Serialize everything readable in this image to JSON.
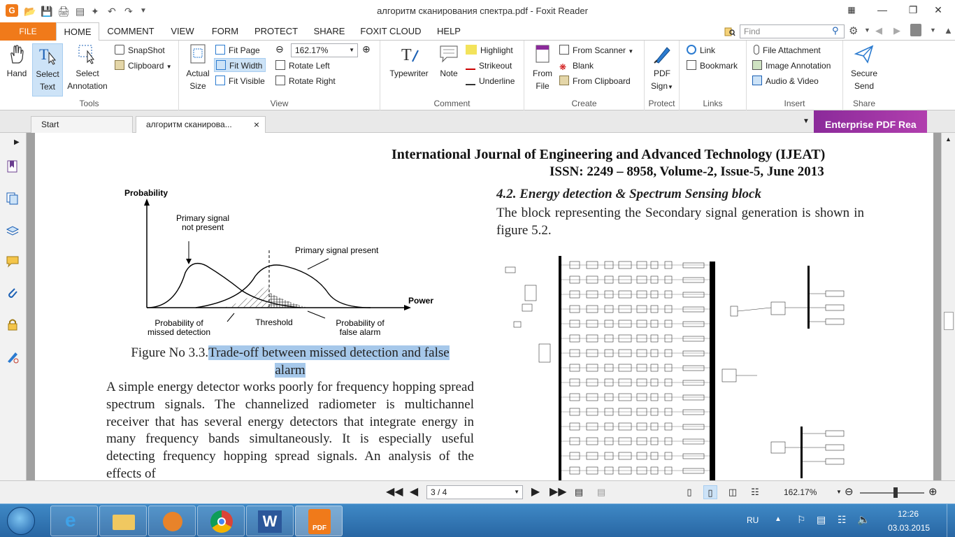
{
  "window": {
    "title": "алгоритм сканирования спектра.pdf - Foxit Reader",
    "min_label": "—",
    "max_label": "❐",
    "close_label": "✕",
    "help_label": "?"
  },
  "menu": {
    "file": "FILE",
    "tabs": [
      "HOME",
      "COMMENT",
      "VIEW",
      "FORM",
      "PROTECT",
      "SHARE",
      "FOXIT CLOUD",
      "HELP"
    ],
    "find_placeholder": "Find"
  },
  "ribbon": {
    "tools": {
      "hand": "Hand",
      "select_text_1": "Select",
      "select_text_2": "Text",
      "select_ann_1": "Select",
      "select_ann_2": "Annotation",
      "snapshot": "SnapShot",
      "clipboard": "Clipboard",
      "label": "Tools"
    },
    "view": {
      "actual_1": "Actual",
      "actual_2": "Size",
      "fit_page": "Fit Page",
      "fit_width": "Fit Width",
      "fit_visible": "Fit Visible",
      "zoom": "162.17%",
      "rotate_left": "Rotate Left",
      "rotate_right": "Rotate Right",
      "label": "View"
    },
    "comment": {
      "typewriter": "Typewriter",
      "note": "Note",
      "highlight": "Highlight",
      "strikeout": "Strikeout",
      "underline": "Underline",
      "label": "Comment"
    },
    "create": {
      "from_file_1": "From",
      "from_file_2": "File",
      "from_scanner": "From Scanner",
      "blank": "Blank",
      "from_clipboard": "From Clipboard",
      "label": "Create"
    },
    "protect": {
      "pdf_sign_1": "PDF",
      "pdf_sign_2": "Sign",
      "label": "Protect"
    },
    "links": {
      "link": "Link",
      "bookmark": "Bookmark",
      "label": "Links"
    },
    "insert": {
      "file_attachment": "File Attachment",
      "image_annotation": "Image Annotation",
      "audio_video": "Audio & Video",
      "label": "Insert"
    },
    "share": {
      "secure_1": "Secure",
      "secure_2": "Send",
      "label": "Share"
    }
  },
  "doctabs": {
    "start": "Start",
    "current": "алгоритм сканирова...",
    "close": "×",
    "enterprise": "Enterprise PDF Rea"
  },
  "document": {
    "journal_line1": "International Journal of Engineering and Advanced Technology (IJEAT)",
    "journal_line2": "ISSN: 2249 – 8958, Volume-2, Issue-5, June 2013",
    "section_heading": "4.2. Energy detection & Spectrum Sensing block",
    "right_para": "The block representing the Secondary signal generation is shown in figure 5.2.",
    "caption_plain": "Figure No 3.3.",
    "caption_highlight_1": "Trade-off between missed detection and false",
    "caption_highlight_2": "alarm",
    "left_para": "A simple energy detector works poorly for frequency hopping spread spectrum signals. The channelized radiometer is multichannel receiver that has several energy detectors that integrate energy in many frequency bands simultaneously. It is especially useful detecting frequency hopping spread signals. An analysis of the effects of",
    "figure": {
      "y_label": "Probability",
      "x_label": "Power",
      "not_present_1": "Primary signal",
      "not_present_2": "not present",
      "present": "Primary signal present",
      "missed_1": "Probability of",
      "missed_2": "missed detection",
      "threshold": "Threshold",
      "false_1": "Probability of",
      "false_2": "false alarm"
    }
  },
  "status": {
    "page": "3 / 4",
    "zoom": "162.17%"
  },
  "taskbar": {
    "lang": "RU",
    "time": "12:26",
    "date": "03.03.2015",
    "pdf_label": "PDF"
  }
}
